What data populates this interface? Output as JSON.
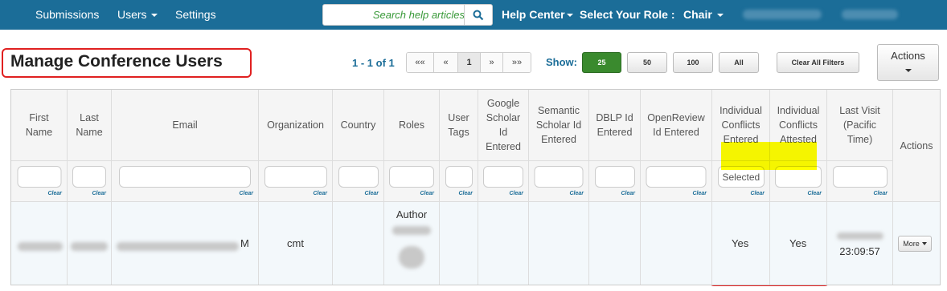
{
  "nav": {
    "submissions": "Submissions",
    "users": "Users",
    "settings": "Settings",
    "search_placeholder": "Search help articles",
    "help_center": "Help Center",
    "select_role_label": "Select Your Role :",
    "role_value": "Chair"
  },
  "page": {
    "title": "Manage Conference Users",
    "page_count": "1 - 1 of 1",
    "show_label": "Show:",
    "clear_all_filters": "Clear All Filters",
    "actions_label": "Actions"
  },
  "pager": [
    "««",
    "«",
    "1",
    "»",
    "»»"
  ],
  "show_options": [
    "25",
    "50",
    "100",
    "All"
  ],
  "table": {
    "columns": [
      {
        "key": "first_name",
        "label": "First Name",
        "filter": ""
      },
      {
        "key": "last_name",
        "label": "Last Name",
        "filter": ""
      },
      {
        "key": "email",
        "label": "Email",
        "filter": ""
      },
      {
        "key": "organization",
        "label": "Organization",
        "filter": ""
      },
      {
        "key": "country",
        "label": "Country",
        "filter": ""
      },
      {
        "key": "roles",
        "label": "Roles",
        "filter": ""
      },
      {
        "key": "user_tags",
        "label": "User Tags",
        "filter": ""
      },
      {
        "key": "google_scholar",
        "label": "Google Scholar Id Entered",
        "filter": ""
      },
      {
        "key": "semantic_scholar",
        "label": "Semantic Scholar Id Entered",
        "filter": ""
      },
      {
        "key": "dblp",
        "label": "DBLP Id Entered",
        "filter": ""
      },
      {
        "key": "openreview",
        "label": "OpenReview Id Entered",
        "filter": ""
      },
      {
        "key": "conflicts_entered",
        "label": "Individual Conflicts Entered",
        "filter": "Selected"
      },
      {
        "key": "conflicts_attested",
        "label": "Individual Conflicts Attested",
        "filter": ""
      },
      {
        "key": "last_visit",
        "label": "Last Visit (Pacific Time)",
        "filter": ""
      },
      {
        "key": "actions",
        "label": "Actions",
        "filter": null
      }
    ],
    "clear_label": "Clear",
    "row": {
      "email_suffix": "M",
      "organization": "cmt",
      "roles": "Author",
      "conflicts_entered": "Yes",
      "conflicts_attested": "Yes",
      "last_visit_time": "23:09:57",
      "more_label": "More"
    }
  },
  "colors": {
    "topbar": "#1b6d98",
    "highlight": "#ffff00",
    "annotation": "#e02020",
    "active_show": "#3a8a2e"
  }
}
